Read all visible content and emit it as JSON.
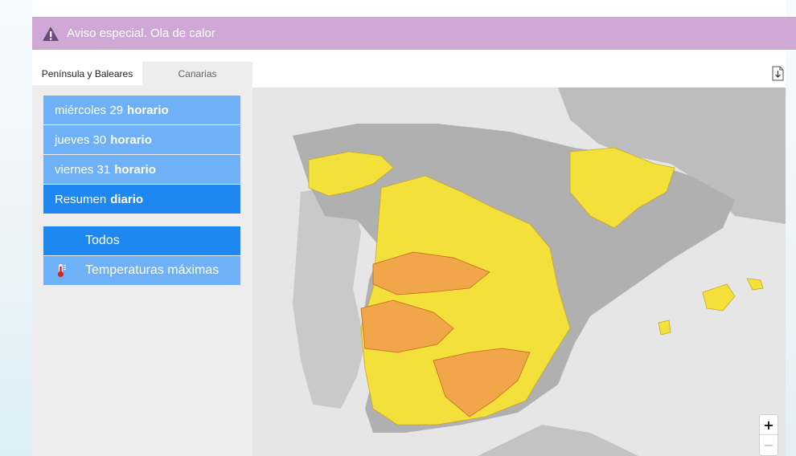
{
  "banner": {
    "title": "Aviso especial. Ola de calor",
    "icon": "warning-icon",
    "color": "#d0a8d5"
  },
  "tabs": [
    {
      "label": "Península y Baleares",
      "active": true
    },
    {
      "label": "Canarias",
      "active": false
    }
  ],
  "days": [
    {
      "label": "miércoles 29",
      "suffix": "horario"
    },
    {
      "label": "jueves 30",
      "suffix": "horario"
    },
    {
      "label": "viernes 31",
      "suffix": "horario"
    },
    {
      "label": "Resumen",
      "suffix": "diario",
      "selected": true
    }
  ],
  "filters": [
    {
      "label": "Todos",
      "selected": true
    },
    {
      "label": "Temperaturas máximas",
      "icon": "thermometer-icon"
    }
  ],
  "map": {
    "colors": {
      "yellow": "#f3e03a",
      "orange": "#f1a64a",
      "land": "#b0b0b0",
      "background": "#e6e6e6"
    }
  },
  "zoom": {
    "in": "+",
    "out": "−"
  },
  "colors": {
    "accent": "#1e87f0",
    "accent_light": "#6fb1f7"
  }
}
